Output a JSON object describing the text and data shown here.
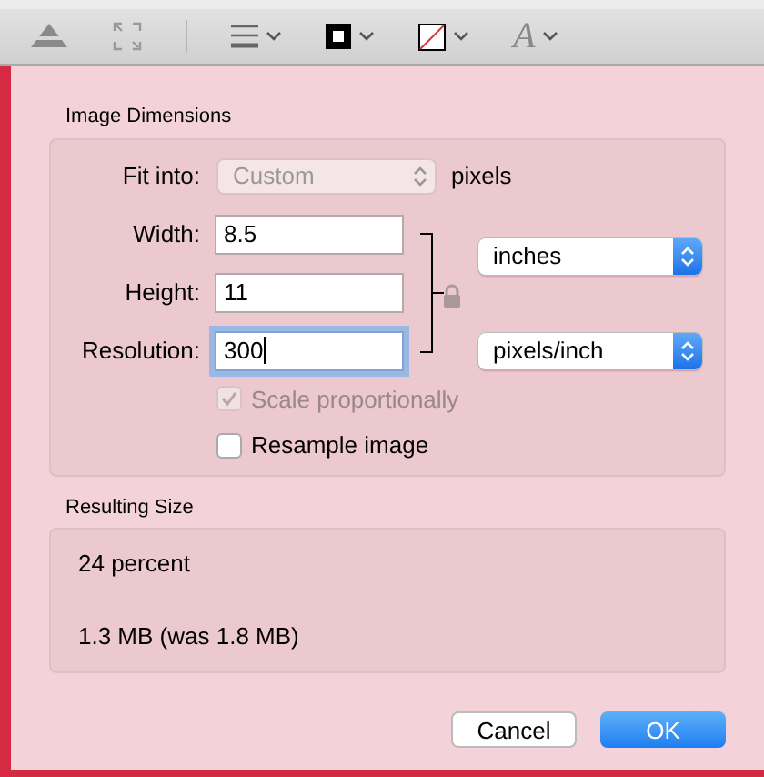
{
  "toolbar": {
    "text_style_glyph": "A"
  },
  "image_dimensions": {
    "title": "Image Dimensions",
    "fit_into": {
      "label": "Fit into:",
      "value": "Custom",
      "disabled": true,
      "unit": "pixels"
    },
    "fields": [
      {
        "label": "Width:",
        "value": "8.5",
        "focused": false
      },
      {
        "label": "Height:",
        "value": "11",
        "focused": false
      },
      {
        "label": "Resolution:",
        "value": "300",
        "focused": true
      }
    ],
    "locked": true,
    "units": [
      {
        "value": "inches"
      },
      {
        "value": "pixels/inch"
      }
    ],
    "checkboxes": [
      {
        "label": "Scale proportionally",
        "checked": true,
        "disabled": true
      },
      {
        "label": "Resample image",
        "checked": false,
        "disabled": false
      }
    ]
  },
  "resulting_size": {
    "title": "Resulting Size",
    "percent": "24 percent",
    "size": "1.3 MB (was 1.8 MB)"
  },
  "buttons": [
    {
      "label": "Cancel",
      "kind": "secondary"
    },
    {
      "label": "OK",
      "kind": "primary"
    }
  ]
}
